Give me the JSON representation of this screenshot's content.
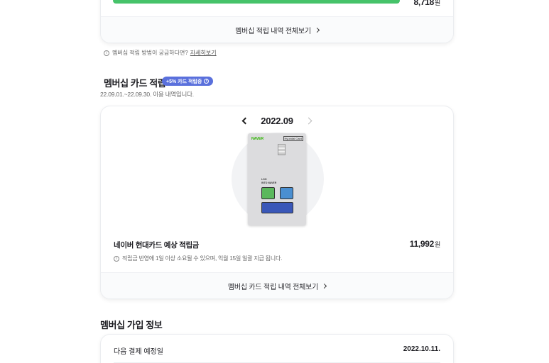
{
  "points_card": {
    "progress_percent": 100,
    "amount": "8,718",
    "unit": "원",
    "footer_link": "멤버십 적립 내역 전체보기"
  },
  "info": {
    "question": "멤버십 적립 방법이 궁금하다면?",
    "link": "자세히보기"
  },
  "card_section": {
    "title": "멤버십 카드 적립",
    "badge": "+5% 카드 적립중",
    "period": "22.09.01.~22.09.30. 이용 내역입니다.",
    "month": "2022.09",
    "card_image": {
      "brand": "NAVER",
      "tag": "Hyundai Card",
      "text_line1": "LOG",
      "text_line2": "INTO NAVER"
    },
    "estimate_label": "네이버 현대카드 예상 적립금",
    "estimate_amount": "11,992",
    "unit": "원",
    "note": "적립금 반영에 1일 이상 소요될 수 있으며, 익월 15일 일괄 지급 됩니다.",
    "footer_link": "멤버십 카드 적립 내역 전체보기"
  },
  "join_section": {
    "title": "멤버십 가입 정보",
    "next_payment_label": "다음 결제 예정일",
    "next_payment_date": "2022.10.11."
  },
  "colors": {
    "progress": "#46c36a",
    "badge": "#5a70dc"
  }
}
